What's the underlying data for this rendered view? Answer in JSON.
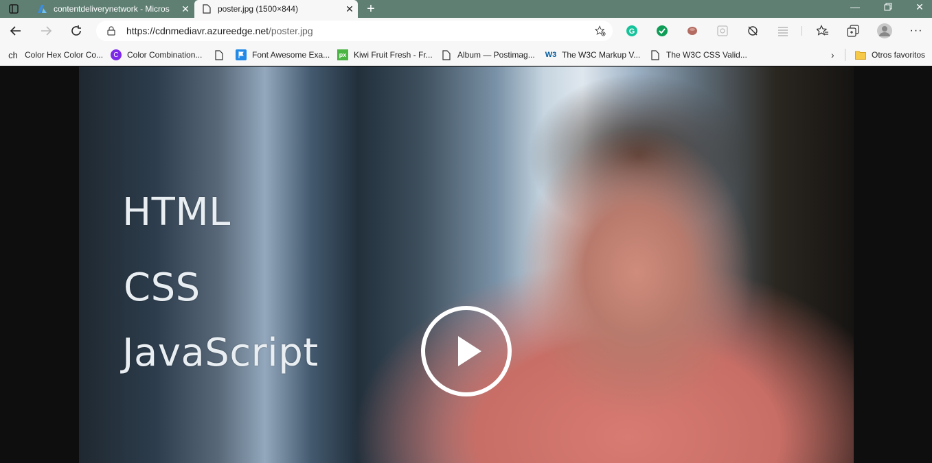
{
  "tabs": [
    {
      "title": "contentdeliverynetwork - Micros",
      "icon": "azure-icon",
      "active": false
    },
    {
      "title": "poster.jpg (1500×844)",
      "icon": "page-icon",
      "active": true
    }
  ],
  "address": {
    "host": "https://cdnmediavr.azureedge.net",
    "path": "/poster.jpg"
  },
  "bookmarks": [
    {
      "label": "Color Hex Color Co...",
      "icon": "ch-icon",
      "icon_text": "ch"
    },
    {
      "label": "Color Combination...",
      "icon": "canva-icon",
      "icon_text": "C"
    },
    {
      "label": "",
      "icon": "page-icon",
      "icon_text": ""
    },
    {
      "label": "Font Awesome Exa...",
      "icon": "flag-icon",
      "icon_text": ""
    },
    {
      "label": "Kiwi Fruit Fresh - Fr...",
      "icon": "px-icon",
      "icon_text": "px"
    },
    {
      "label": "Album — Postimag...",
      "icon": "page-icon",
      "icon_text": ""
    },
    {
      "label": "The W3C Markup V...",
      "icon": "w3-icon",
      "icon_text": "W3"
    },
    {
      "label": "The W3C CSS Valid...",
      "icon": "page-icon",
      "icon_text": ""
    }
  ],
  "other_favorites": "Otros favoritos",
  "poster": {
    "line1": "HTML",
    "line2": "CSS",
    "line3": "JavaScript"
  },
  "colors": {
    "tabbar": "#5f7f73",
    "toolbar": "#f7f7f7",
    "accent_green": "#0f9d58"
  }
}
